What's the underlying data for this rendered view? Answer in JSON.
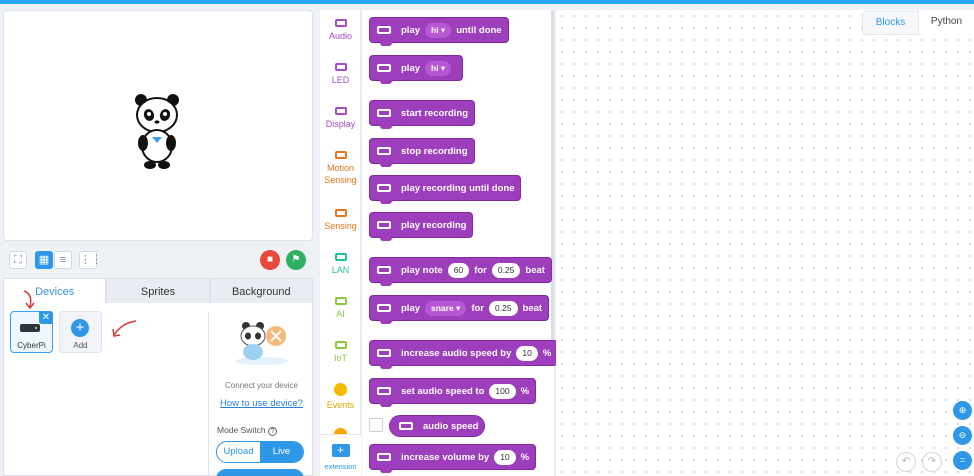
{
  "categories": [
    {
      "label": "Audio",
      "color": "#a64dc6"
    },
    {
      "label": "LED",
      "color": "#a64dc6"
    },
    {
      "label": "Display",
      "color": "#a64dc6"
    },
    {
      "label": "Motion Sensing",
      "color": "#e5761b"
    },
    {
      "label": "Sensing",
      "color": "#e5761b"
    },
    {
      "label": "LAN",
      "color": "#1fbf9b"
    },
    {
      "label": "AI",
      "color": "#8dc63f"
    },
    {
      "label": "IoT",
      "color": "#8dc63f"
    },
    {
      "label": "Events",
      "color": "#f5b800"
    },
    {
      "label": "extension",
      "color": "#2e97e8"
    }
  ],
  "blocks": {
    "play_until_done": {
      "word": "play",
      "dropdown": "hi ▾",
      "suffix": "until done"
    },
    "play": {
      "word": "play",
      "dropdown": "hi ▾"
    },
    "start_recording": "start recording",
    "stop_recording": "stop recording",
    "play_recording_until_done": "play recording until done",
    "play_recording": "play recording",
    "play_note": {
      "word": "play note",
      "note": "60",
      "for_label": "for",
      "beats": "0.25",
      "beat_label": "beat"
    },
    "play_drum": {
      "word": "play",
      "drum": "snare ▾",
      "for_label": "for",
      "beats": "0.25",
      "beat_label": "beat"
    },
    "increase_speed": {
      "word": "increase audio speed by",
      "value": "10",
      "unit": "%"
    },
    "set_speed": {
      "word": "set audio speed to",
      "value": "100",
      "unit": "%"
    },
    "audio_speed": "audio speed",
    "increase_volume": {
      "word": "increase volume by",
      "value": "10",
      "unit": "%"
    }
  },
  "stage_tabs": [
    "Devices",
    "Sprites",
    "Background"
  ],
  "devices": [
    {
      "label": "CyberPi"
    },
    {
      "label": "Add"
    }
  ],
  "device_info": {
    "connect_text": "Connect your device",
    "how_to": "How to use device?",
    "mode_switch": "Mode Switch",
    "mode_upload": "Upload",
    "mode_live": "Live"
  },
  "code_tabs": {
    "blocks": "Blocks",
    "python": "Python"
  },
  "icons": {
    "fullscreen": "fullscreen-icon",
    "layout": "layout-icon",
    "list": "list-icon",
    "grid": "grid-icon",
    "stop": "stop-icon",
    "go": "green-flag-icon",
    "zoom_in": "zoom-in-icon",
    "zoom_out": "zoom-out-icon",
    "reset": "zoom-reset-icon",
    "undo": "undo-icon",
    "redo": "redo-icon",
    "help": "help-icon"
  },
  "colors": {
    "accent": "#2e97e8",
    "audio_block": "#9d3ebd",
    "stop_button": "#e8473c",
    "go_button": "#2fb061",
    "arrow": "#d23a3a"
  }
}
